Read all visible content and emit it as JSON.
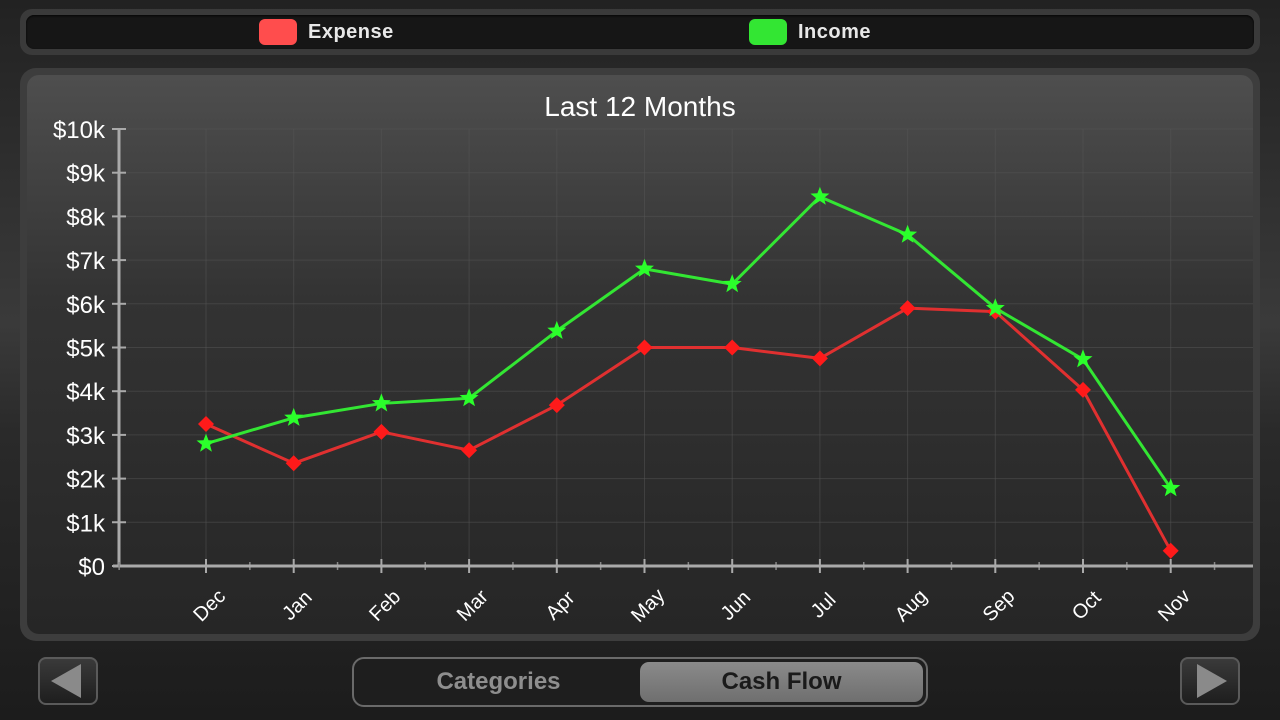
{
  "legend": {
    "items": [
      {
        "label": "Expense",
        "color": "#ff4d4d"
      },
      {
        "label": "Income",
        "color": "#33e633"
      }
    ]
  },
  "chart_data": {
    "type": "line",
    "title": "Last 12 Months",
    "categories": [
      "Dec",
      "Jan",
      "Feb",
      "Mar",
      "Apr",
      "May",
      "Jun",
      "Jul",
      "Aug",
      "Sep",
      "Oct",
      "Nov"
    ],
    "ylim": [
      0,
      10000
    ],
    "yticks": [
      "$0",
      "$1k",
      "$2k",
      "$3k",
      "$4k",
      "$5k",
      "$6k",
      "$7k",
      "$8k",
      "$9k",
      "$10k"
    ],
    "grid": true,
    "series": [
      {
        "name": "Expense",
        "color": "#e03030",
        "marker": "diamond",
        "values": [
          3250,
          2350,
          3070,
          2650,
          3680,
          5000,
          5000,
          4750,
          5900,
          5820,
          4030,
          350
        ]
      },
      {
        "name": "Income",
        "color": "#33e633",
        "marker": "star",
        "values": [
          2800,
          3390,
          3720,
          3840,
          5380,
          6800,
          6450,
          8450,
          7580,
          5900,
          4730,
          1780
        ]
      }
    ]
  },
  "tabs": {
    "categories": "Categories",
    "cash_flow": "Cash Flow"
  },
  "nav": {
    "prev_icon": "triangle-left-icon",
    "next_icon": "triangle-right-icon"
  }
}
